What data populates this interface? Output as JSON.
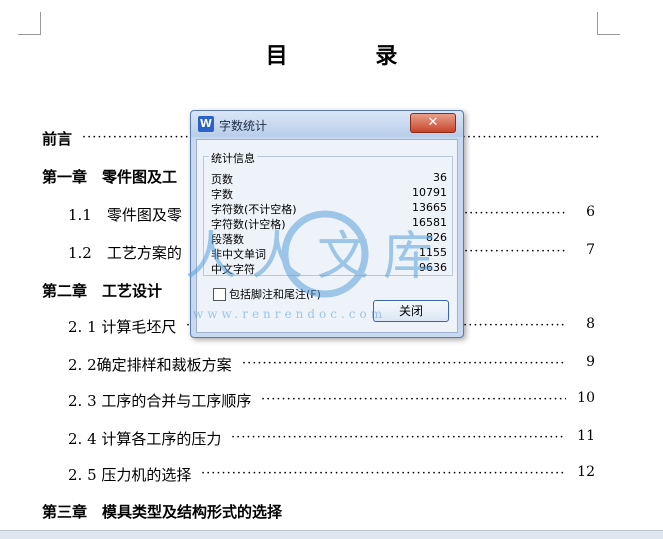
{
  "document": {
    "title": "目 录",
    "toc": [
      {
        "label": "前言",
        "page": "",
        "level": "chapter"
      },
      {
        "label": "第一章　零件图及工",
        "page": "",
        "level": "chapter"
      },
      {
        "label": "1.1　零件图及零",
        "page": "6",
        "level": "section"
      },
      {
        "label": "1.2　工艺方案的",
        "page": "7",
        "level": "section"
      },
      {
        "label": "第二章　工艺设计",
        "page": "",
        "level": "chapter"
      },
      {
        "label": "2. 1 计算毛坯尺",
        "page": "8",
        "level": "section"
      },
      {
        "label": "2. 2确定排样和裁板方案",
        "page": "9",
        "level": "section"
      },
      {
        "label": "2. 3 工序的合并与工序顺序",
        "page": "10",
        "level": "section"
      },
      {
        "label": "2. 4 计算各工序的压力",
        "page": "11",
        "level": "section"
      },
      {
        "label": "2. 5 压力机的选择",
        "page": "12",
        "level": "section"
      },
      {
        "label": "第三章　模具类型及结构形式的选择",
        "page": "",
        "level": "chapter"
      }
    ]
  },
  "dialog": {
    "title": "字数统计",
    "app_icon": "W",
    "close_glyph": "✕",
    "group_label": "统计信息",
    "stats": [
      {
        "label": "页数",
        "value": "36"
      },
      {
        "label": "字数",
        "value": "10791"
      },
      {
        "label": "字符数(不计空格)",
        "value": "13665"
      },
      {
        "label": "字符数(计空格)",
        "value": "16581"
      },
      {
        "label": "段落数",
        "value": "826"
      },
      {
        "label": "非中文单词",
        "value": "1155"
      },
      {
        "label": "中文字符",
        "value": "9636"
      }
    ],
    "checkbox_label": "包括脚注和尾注(F)",
    "checkbox_checked": false,
    "close_button": "关闭"
  },
  "watermark": {
    "text": "人人文库",
    "url": "www.renrendoc.com"
  },
  "colors": {
    "dialog_bg": "#c8d8ee",
    "accent": "#2a63c8",
    "close_red": "#c8452c",
    "watermark": "#5aa0d8"
  }
}
